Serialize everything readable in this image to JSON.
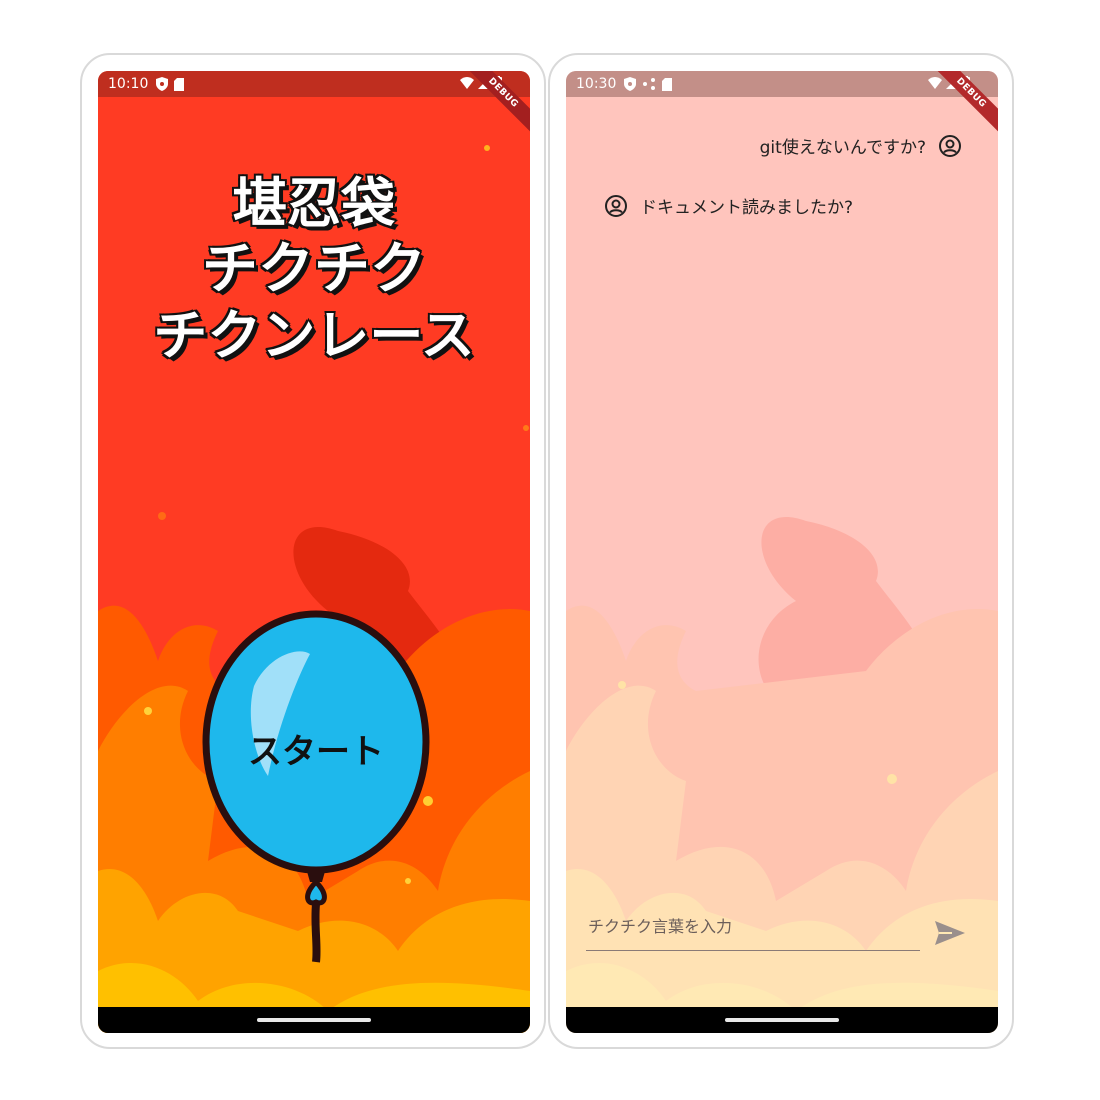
{
  "left_screen": {
    "status_time": "10:10",
    "debug_label": "DEBUG",
    "title_lines": [
      "堪忍袋",
      "チクチク",
      "チクンレース"
    ],
    "start_label": "スタート"
  },
  "right_screen": {
    "status_time": "10:30",
    "debug_label": "DEBUG",
    "messages": [
      {
        "side": "sent",
        "text": "git使えないんですか?"
      },
      {
        "side": "received",
        "text": "ドキュメント読みましたか?"
      }
    ],
    "input_placeholder": "チクチク言葉を入力"
  },
  "colors": {
    "left_bg": "#ff3b23",
    "balloon": "#1eb8ec",
    "right_bg": "#ffc5bd"
  }
}
